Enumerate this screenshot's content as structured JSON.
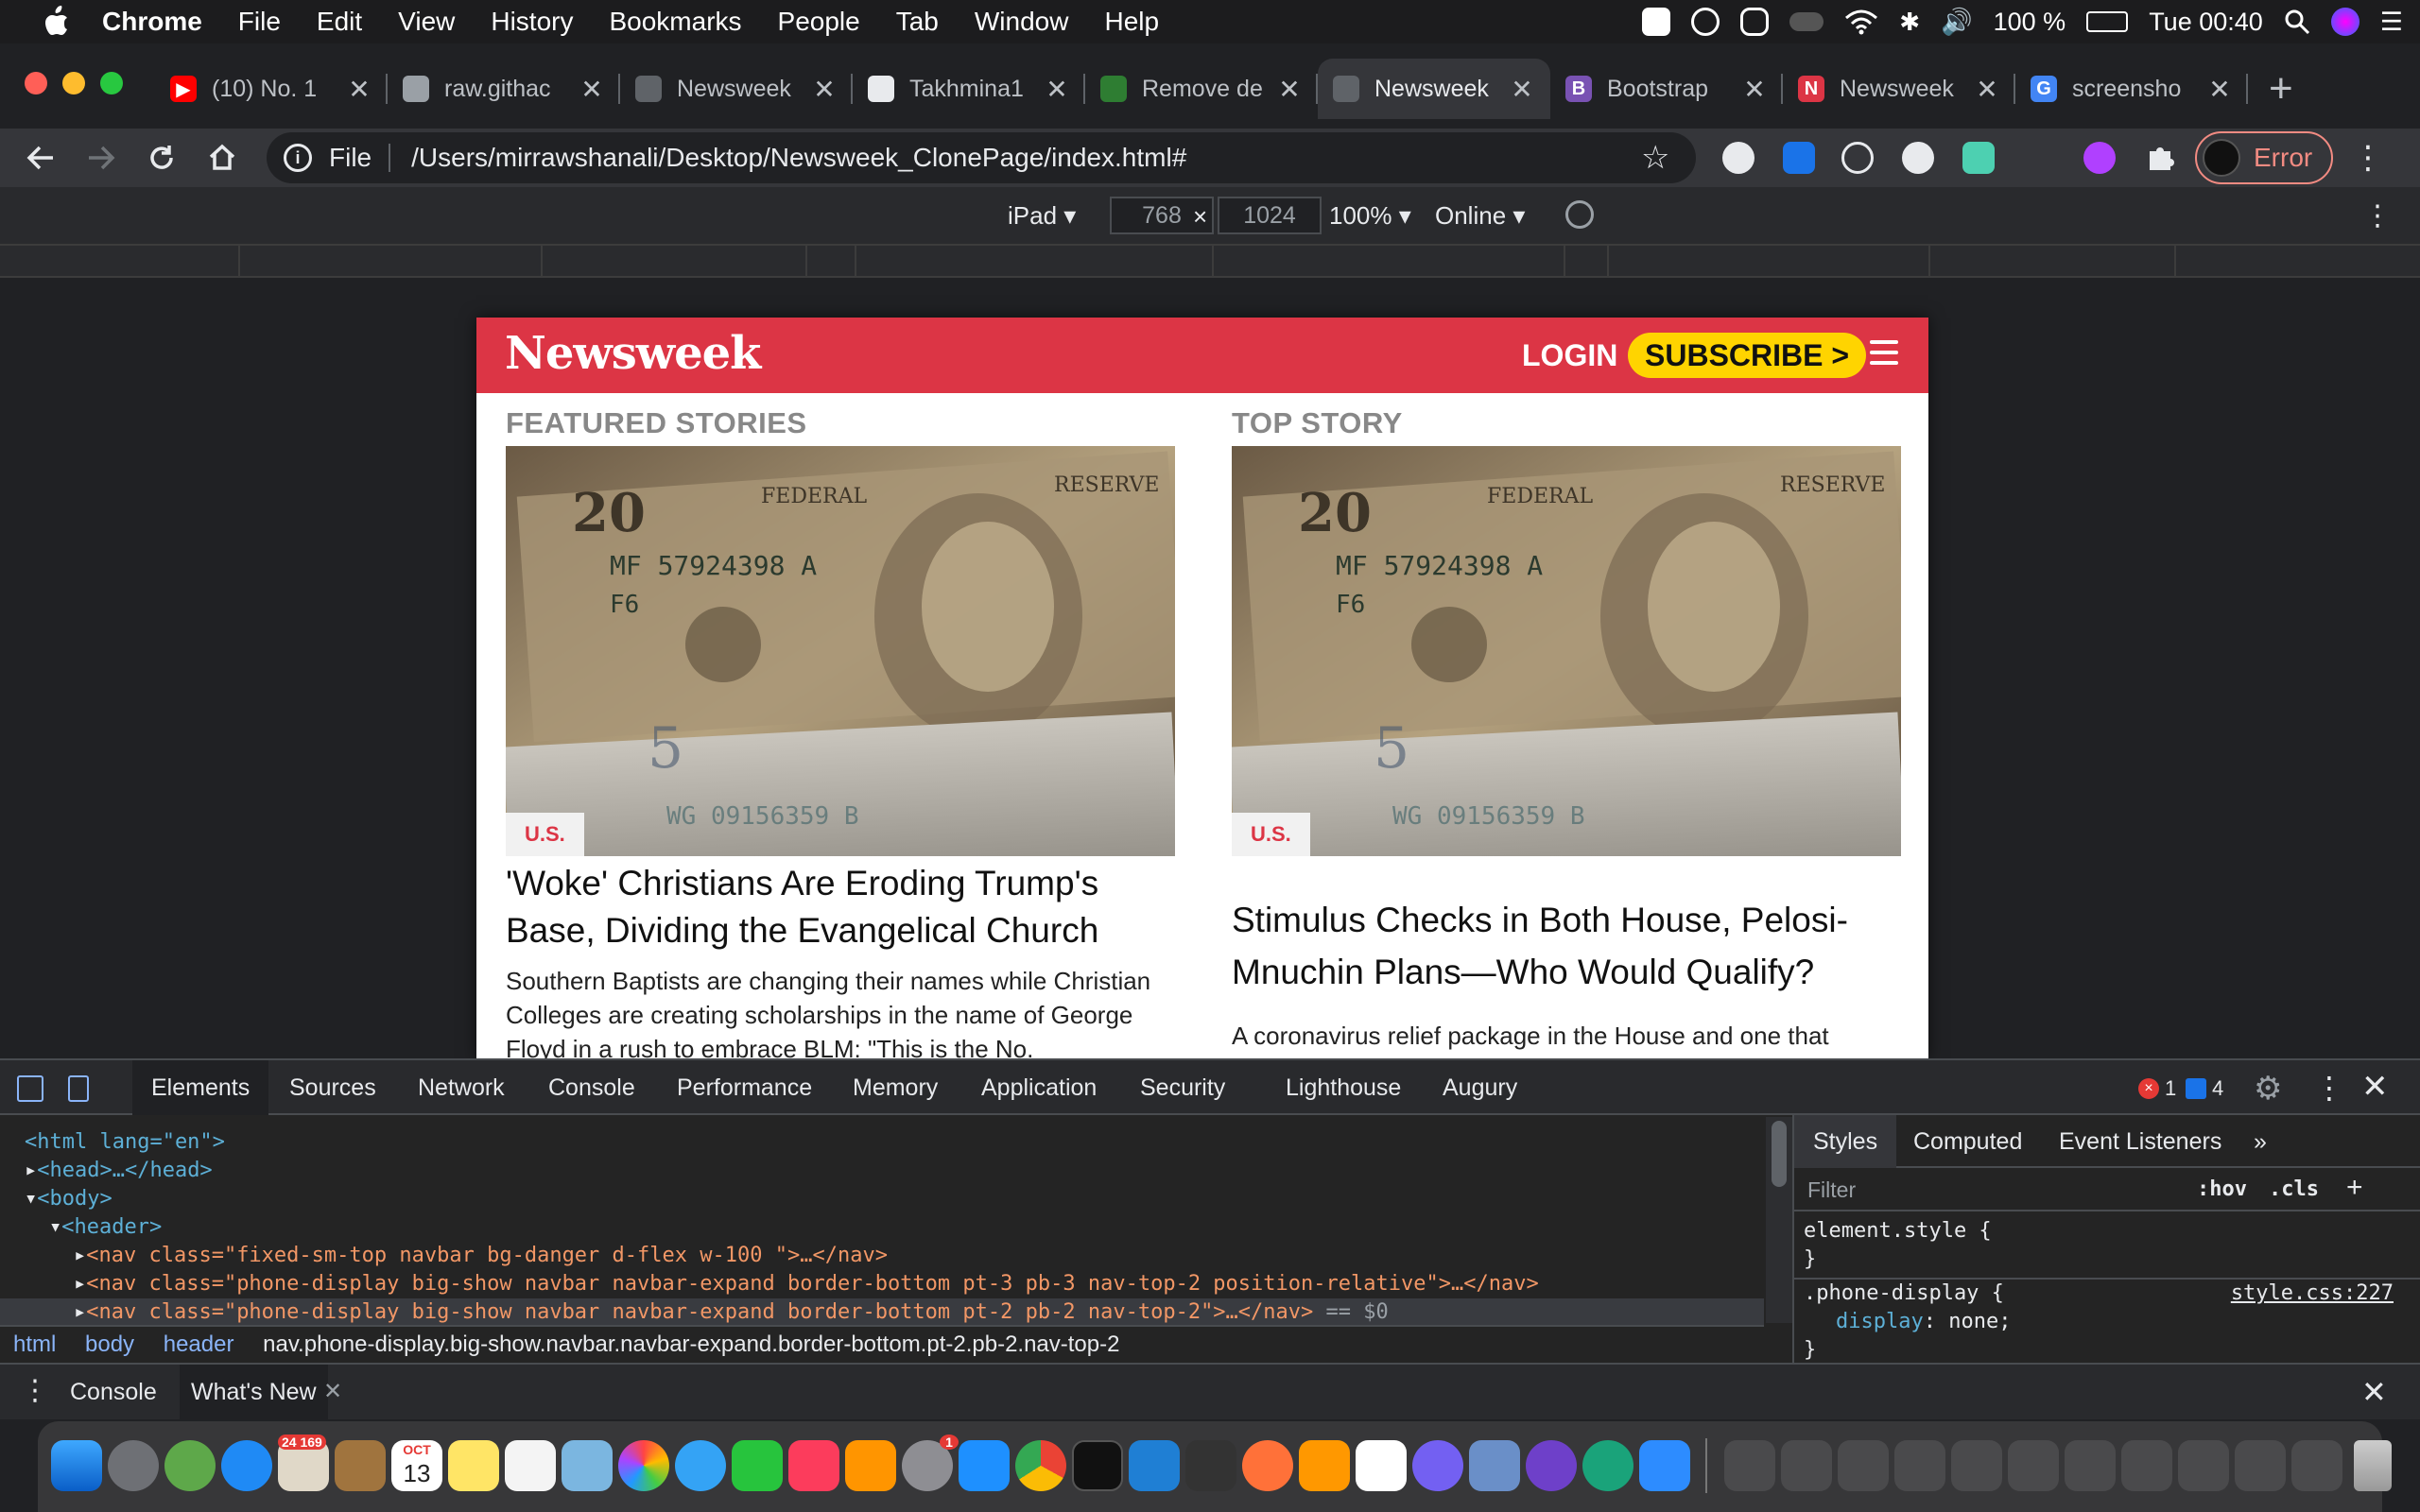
{
  "menubar": {
    "app": "Chrome",
    "items": [
      "File",
      "Edit",
      "View",
      "History",
      "Bookmarks",
      "People",
      "Tab",
      "Window",
      "Help"
    ],
    "battery": "100 %",
    "clock": "Tue 00:40"
  },
  "tabs": [
    {
      "title": "(10) No. 1",
      "favicon": "youtube-icon",
      "color": "#ff0000",
      "glyph": "▶"
    },
    {
      "title": "raw.githac",
      "favicon": "githack-icon",
      "color": "#9aa0a6",
      "glyph": ""
    },
    {
      "title": "Newsweek",
      "favicon": "globe-icon",
      "color": "#5f6368",
      "glyph": ""
    },
    {
      "title": "Takhmina1",
      "favicon": "github-icon",
      "color": "#e8eaed",
      "glyph": ""
    },
    {
      "title": "Remove de",
      "favicon": "remove-bg-icon",
      "color": "#2e7d32",
      "glyph": ""
    },
    {
      "title": "Newsweek",
      "favicon": "globe-icon",
      "color": "#5f6368",
      "glyph": "",
      "active": true
    },
    {
      "title": "Bootstrap",
      "favicon": "bootstrap-icon",
      "color": "#7952b3",
      "glyph": "B"
    },
    {
      "title": "Newsweek",
      "favicon": "newsweek-icon",
      "color": "#dc3545",
      "glyph": "N"
    },
    {
      "title": "screensho",
      "favicon": "google-icon",
      "color": "#4285f4",
      "glyph": "G"
    }
  ],
  "omnibox": {
    "scheme": "File",
    "url": "/Users/mirrawshanali/Desktop/Newsweek_ClonePage/index.html#"
  },
  "profile": {
    "label": "Error"
  },
  "device_toolbar": {
    "device": "iPad ▾",
    "width": "768",
    "height": "1024",
    "zoom": "100% ▾",
    "network": "Online ▾"
  },
  "site": {
    "logo": "Newsweek",
    "login": "LOGIN",
    "subscribe": "SUBSCRIBE >",
    "featured": {
      "label": "FEATURED STORIES",
      "tag": "U.S.",
      "title": "'Woke' Christians Are Eroding Trump's Base, Dividing the Evangelical Church",
      "body": "Southern Baptists are changing their names while Christian Colleges are creating scholarships in the name of George Floyd in a rush to embrace BLM: \"This is the No."
    },
    "top": {
      "label": "TOP STORY",
      "tag": "U.S.",
      "title": "Stimulus Checks in Both House, Pelosi-Mnuchin Plans—Who Would Qualify?",
      "body": "A coronavirus relief package in the House and one that"
    },
    "colors": {
      "brand_red": "#dc3545",
      "subscribe_yellow": "#ffd400"
    }
  },
  "devtools": {
    "tabs": [
      "Elements",
      "Sources",
      "Network",
      "Console",
      "Performance",
      "Memory",
      "Application",
      "Security",
      "Lighthouse",
      "Augury"
    ],
    "errors": "1",
    "messages": "4",
    "dom": {
      "html_open": "<html lang=\"en\">",
      "head": "<head>…</head>",
      "body_open": "<body>",
      "header_open": "<header>",
      "nav1": "<nav class=\"fixed-sm-top navbar bg-danger d-flex w-100 \">…</nav>",
      "nav2": "<nav class=\"phone-display big-show navbar navbar-expand border-bottom pt-3 pb-3 nav-top-2 position-relative\">…</nav>",
      "nav3": "<nav class=\"phone-display big-show navbar navbar-expand border-bottom pt-2 pb-2 nav-top-2\">…</nav>",
      "nav3_suffix": "== $0"
    },
    "breadcrumbs": [
      "html",
      "body",
      "header",
      "nav.phone-display.big-show.navbar.navbar-expand.border-bottom.pt-2.pb-2.nav-top-2"
    ],
    "styles": {
      "tabs": [
        "Styles",
        "Computed",
        "Event Listeners",
        "»"
      ],
      "filter_placeholder": "Filter",
      "hov": ":hov",
      "cls": ".cls",
      "rule1_selector": "element.style {",
      "rule1_close": "}",
      "rule2_selector": ".phone-display {",
      "rule2_source": "style.css:227",
      "rule2_prop": "display",
      "rule2_value": "none;",
      "rule2_close": "}"
    },
    "drawer_tabs": [
      "Console",
      "What's New"
    ]
  },
  "dock": {
    "mail_badge": "24 169",
    "calendar_month": "OCT",
    "calendar_day": "13",
    "prefs_badge": "1"
  }
}
